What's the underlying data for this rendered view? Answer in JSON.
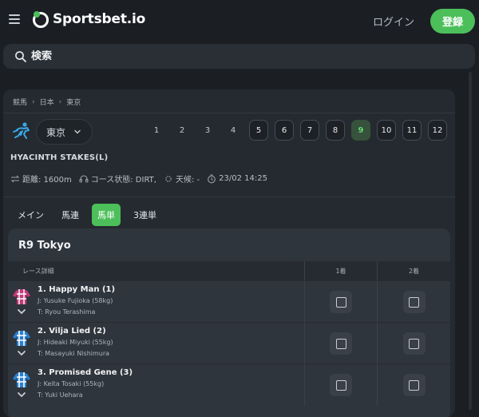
{
  "header": {
    "brand": "Sportsbet.io",
    "login_label": "ログイン",
    "register_label": "登録"
  },
  "search": {
    "placeholder": "検索"
  },
  "breadcrumb": [
    "競馬",
    "日本",
    "東京"
  ],
  "location": {
    "selected": "東京"
  },
  "race_numbers": [
    {
      "label": "1",
      "style": "plain"
    },
    {
      "label": "2",
      "style": "plain"
    },
    {
      "label": "3",
      "style": "plain"
    },
    {
      "label": "4",
      "style": "plain"
    },
    {
      "label": "5",
      "style": "boxed"
    },
    {
      "label": "6",
      "style": "boxed"
    },
    {
      "label": "7",
      "style": "boxed"
    },
    {
      "label": "8",
      "style": "boxed"
    },
    {
      "label": "9",
      "style": "active"
    },
    {
      "label": "10",
      "style": "boxed"
    },
    {
      "label": "11",
      "style": "boxed"
    },
    {
      "label": "12",
      "style": "boxed"
    }
  ],
  "race": {
    "title": "HYACINTH STAKES(L)",
    "distance": "距離: 1600m",
    "course": "コース状態: DIRT,",
    "weather": "天候: -",
    "datetime": "23/02 14:25"
  },
  "tabs": [
    {
      "label": "メイン",
      "active": false
    },
    {
      "label": "馬連",
      "active": false
    },
    {
      "label": "馬単",
      "active": true
    },
    {
      "label": "3連単",
      "active": false
    }
  ],
  "card": {
    "title": "R9 Tokyo",
    "columns": {
      "detail": "レース詳細",
      "first": "1着",
      "second": "2着"
    },
    "runners": [
      {
        "name": "1. Happy Man (1)",
        "jockey": "J: Yusuke Fujioka (58kg)",
        "trainer": "T: Ryou Terashima",
        "silk": "magenta-check"
      },
      {
        "name": "2. Vilja Lied (2)",
        "jockey": "J: Hideaki Miyuki (55kg)",
        "trainer": "T: Masayuki Nishimura",
        "silk": "blue-check"
      },
      {
        "name": "3. Promised Gene (3)",
        "jockey": "J: Keita Tosaki (55kg)",
        "trainer": "T: Yuki Uehara",
        "silk": "blue-check"
      }
    ]
  },
  "colors": {
    "accent": "#4cbf5a",
    "background": "#1b1f24",
    "panel": "#252a30"
  }
}
